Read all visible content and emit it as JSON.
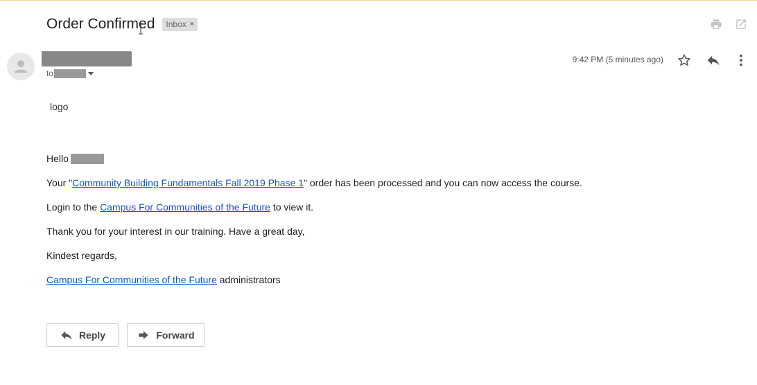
{
  "subject": "Order Confirmed",
  "label": {
    "name": "Inbox",
    "remove": "×"
  },
  "header": {
    "to_prefix": "to",
    "timestamp": "9:42 PM (5 minutes ago)"
  },
  "icons": {
    "print": "print-icon",
    "popout": "open-in-new-window-icon",
    "star": "star-icon",
    "reply": "reply-icon",
    "more": "more-vert-icon",
    "avatar": "default-avatar-icon"
  },
  "body": {
    "logo_alt": "logo",
    "greeting": "Hello",
    "order_prefix": "Your \"",
    "order_link": "Community Building Fundamentals Fall 2019 Phase 1",
    "order_suffix": "\" order has been processed and you can now access the course.",
    "login_prefix": "Login to the ",
    "login_link": "Campus For Communities of the Future",
    "login_suffix": " to view it.",
    "thanks": "Thank you for your interest in our training. Have a great day,",
    "regards": "Kindest regards,",
    "signature_link": "Campus For Communities of the Future",
    "signature_suffix": " administrators"
  },
  "actions": {
    "reply": "Reply",
    "forward": "Forward"
  },
  "colors": {
    "link": "#1155cc",
    "redaction": "#888888",
    "chip_bg": "#dddddd"
  }
}
